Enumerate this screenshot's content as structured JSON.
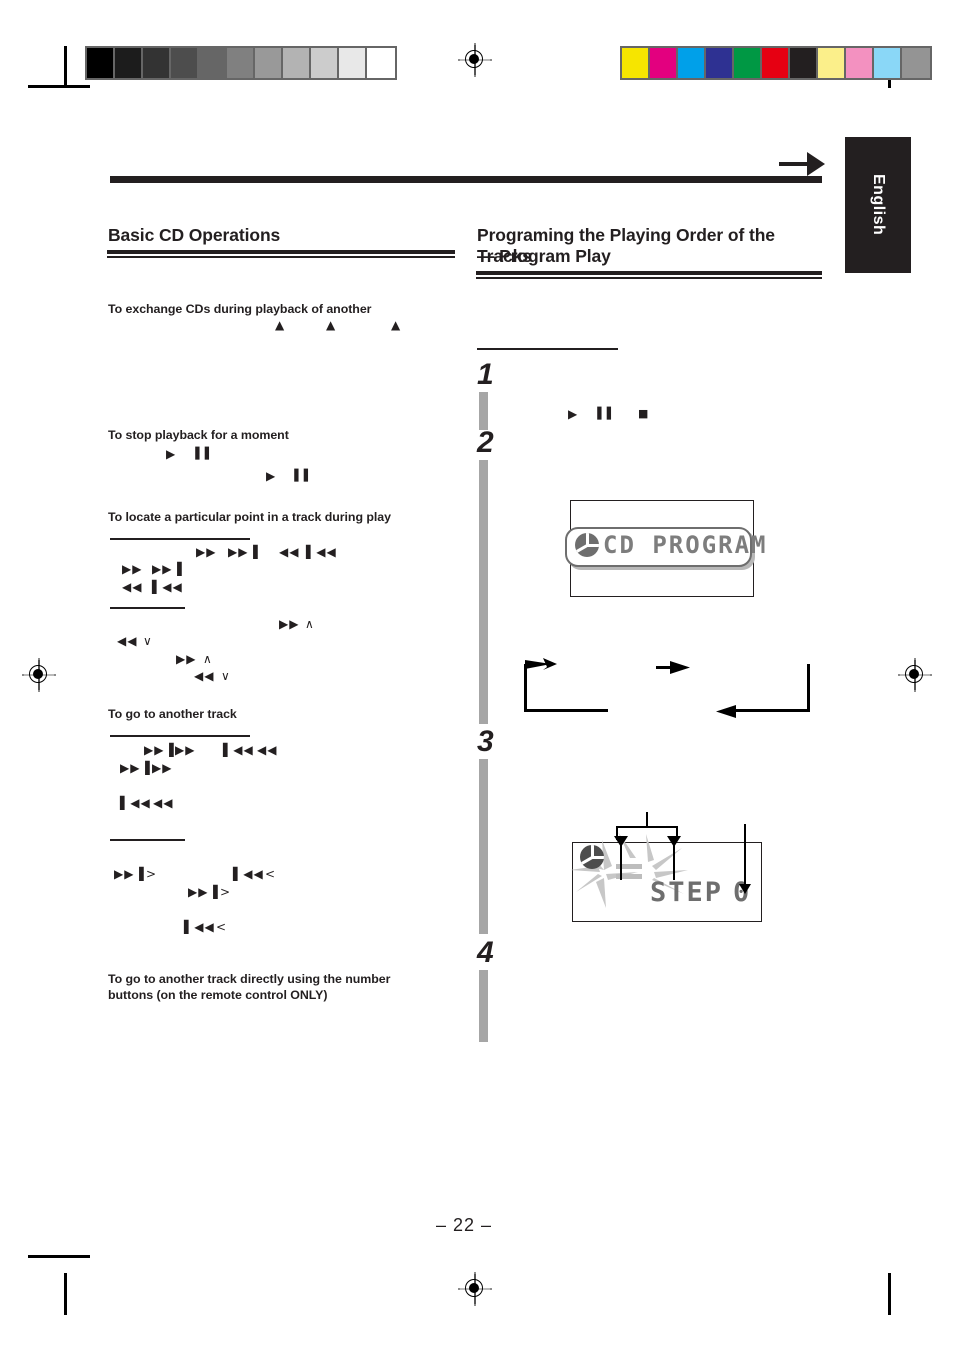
{
  "page": {
    "number_label": "– 22 –",
    "language_tab": "English"
  },
  "print_marks": {
    "grayscale_wedge": [
      "#000000",
      "#1c1c1c",
      "#333333",
      "#4d4d4d",
      "#666666",
      "#808080",
      "#999999",
      "#b3b3b3",
      "#cccccc",
      "#e8e8e8",
      "#ffffff"
    ],
    "color_bars": [
      "#f6e500",
      "#e3007f",
      "#00a0e9",
      "#2e3192",
      "#009844",
      "#e60012",
      "#231f20",
      "#fbef8a",
      "#f391c0",
      "#8ad7f7",
      "#949494"
    ]
  },
  "left_column": {
    "heading": "Basic CD Operations",
    "sections": [
      {
        "title": "To exchange CDs during playback of another",
        "symbol_rows": [
          {
            "items": [
              "▲",
              "▲",
              "▲"
            ]
          }
        ]
      },
      {
        "title": "To stop playback for a moment",
        "symbol_rows": [
          {
            "items": [
              "▶",
              "▐▐"
            ]
          },
          {
            "items": [
              "▶",
              "▐▐"
            ]
          }
        ]
      },
      {
        "title": "To locate a particular point in a track during play",
        "symbol_rows": [
          {
            "items": [
              "▶▶",
              "▶▶▐",
              "◀◀",
              "▌◀◀"
            ]
          },
          {
            "items": [
              "▶▶",
              "▶▶▐"
            ]
          },
          {
            "items": [
              "◀◀",
              "▌◀◀"
            ]
          },
          {
            "items": [
              "▶▶",
              "∧"
            ]
          },
          {
            "items": [
              "◀◀",
              "∨"
            ]
          },
          {
            "items": [
              "▶▶",
              "∧"
            ]
          },
          {
            "items": [
              "◀◀",
              "∨"
            ]
          }
        ]
      },
      {
        "title": "To go to another track",
        "symbol_rows": [
          {
            "items": [
              "▶▶▐",
              "▶▶",
              "▌◀◀",
              "◀◀"
            ]
          },
          {
            "items": [
              "▶▶▐",
              "▶▶"
            ]
          },
          {
            "items": [
              "▌◀◀",
              "◀◀"
            ]
          },
          {
            "items": [
              "▶▶▐",
              ">",
              "▌◀◀",
              "<"
            ]
          },
          {
            "items": [
              "▶▶▐",
              ">"
            ]
          },
          {
            "items": [
              "▌◀◀",
              "<"
            ]
          }
        ]
      },
      {
        "title": "To go to another track directly using the number buttons (on the remote control ONLY)",
        "symbol_rows": []
      }
    ]
  },
  "right_column": {
    "heading_line1": "Programing the Playing Order of the Tracks",
    "heading_line2": "— Program Play",
    "steps": [
      {
        "number": "1",
        "symbols": [
          "▶",
          "▐▐",
          "■"
        ]
      },
      {
        "number": "2",
        "symbols": []
      },
      {
        "number": "3",
        "symbols": []
      },
      {
        "number": "4",
        "symbols": []
      }
    ],
    "displays": [
      {
        "name": "cd-program-display",
        "icon": "disc-icon",
        "text": "CD PROGRAM"
      },
      {
        "name": "step-display",
        "icon": "disc-icon",
        "text": "STEP",
        "value": "0"
      }
    ]
  }
}
